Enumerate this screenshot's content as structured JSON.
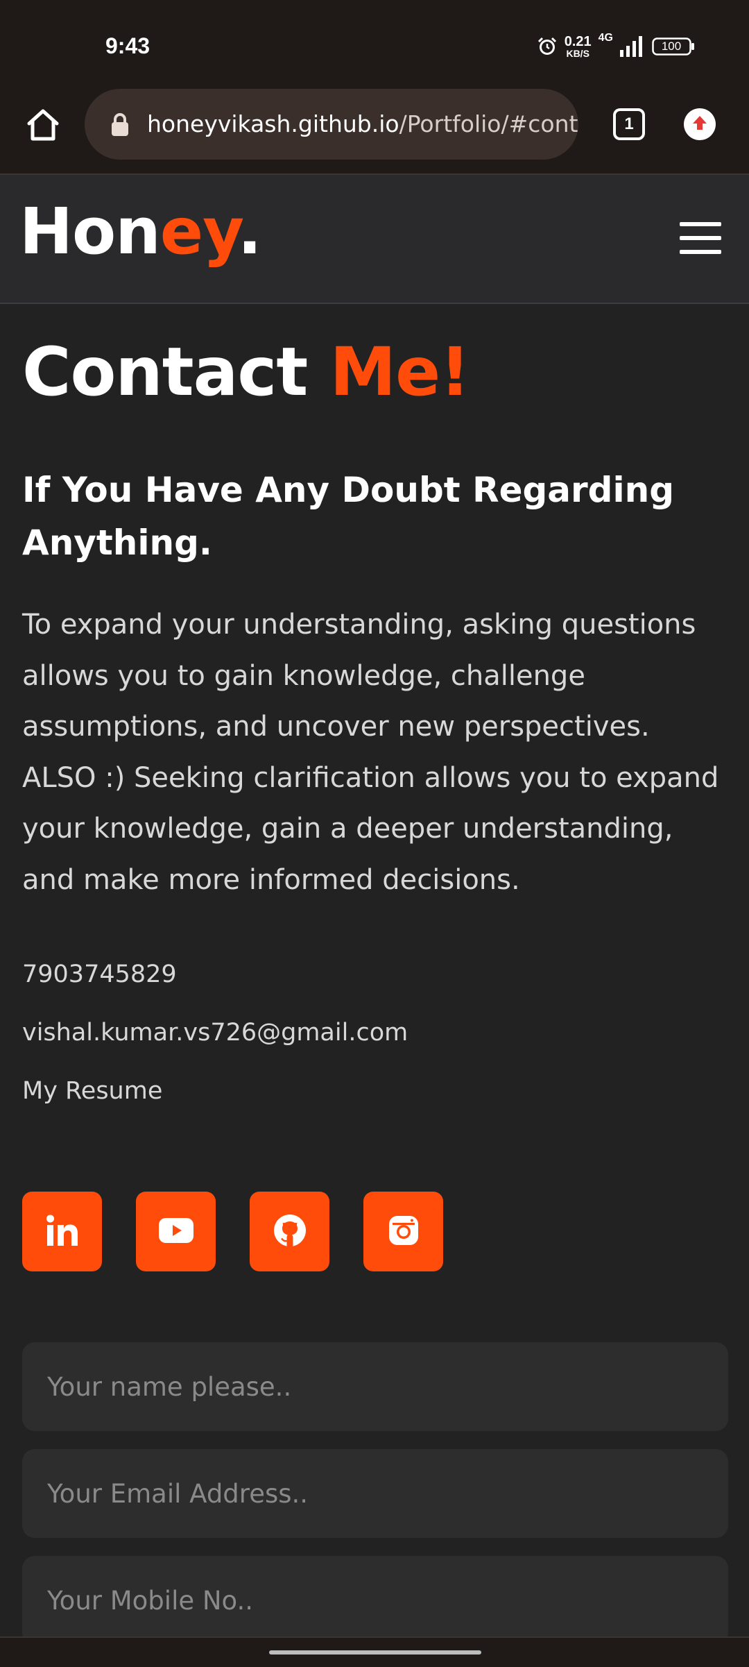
{
  "status_bar": {
    "time": "9:43",
    "net_speed_value": "0.21",
    "net_speed_unit": "KB/S",
    "network_type": "4G",
    "battery": "100"
  },
  "browser": {
    "url_domain": "honeyvikash.github.io",
    "url_path": "/Portfolio/#cont",
    "tab_count": "1"
  },
  "header": {
    "logo_part1": "Hon",
    "logo_part2": "ey",
    "logo_part3": "."
  },
  "contact": {
    "title_part1": "Contact ",
    "title_part2": "Me!",
    "subtitle": "If You Have Any Doubt Regarding Anything.",
    "paragraph": "To expand your understanding, asking questions allows you to gain knowledge, challenge assumptions, and uncover new perspectives. ALSO :) Seeking clarification allows you to expand your knowledge, gain a deeper understanding, and make more informed decisions.",
    "phone": "7903745829",
    "email": "vishal.kumar.vs726@gmail.com",
    "resume_link": "My Resume"
  },
  "socials": [
    "linkedin-icon",
    "youtube-icon",
    "github-icon",
    "instagram-icon"
  ],
  "form": {
    "name_placeholder": "Your name please..",
    "email_placeholder": "Your Email Address..",
    "mobile_placeholder": "Your Mobile No.."
  },
  "colors": {
    "accent": "#ff4c0a",
    "background": "#222222",
    "header_bg": "#2a2a2c",
    "field_bg": "#2d2d2d"
  }
}
